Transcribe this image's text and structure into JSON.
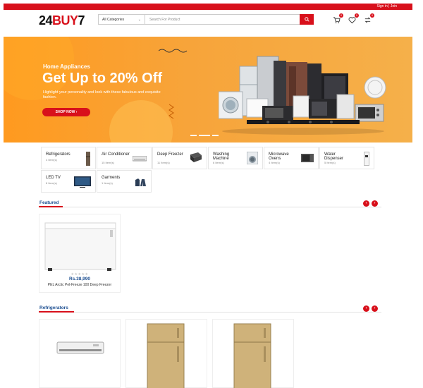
{
  "topbar": {
    "auth": "Sign in | Join"
  },
  "header": {
    "logo_main": "24",
    "logo_red": "BUY",
    "logo_end": "7",
    "category_select": "All Categories",
    "search_placeholder": "Search For Product",
    "cart_count": "0",
    "wishlist_count": "0",
    "compare_count": "0"
  },
  "hero": {
    "kicker": "Home Appliances",
    "headline": "Get Up to 20% Off",
    "subtext": "Highlight your personality and look with these fabulous and exquisite fashion.",
    "cta": "SHOP NOW",
    "slides": 3,
    "active_slide": 2
  },
  "categories": [
    {
      "name": "Refrigerators",
      "count": "4 Item(s)"
    },
    {
      "name": "Air Conditioner",
      "count": "15 Item(s)"
    },
    {
      "name": "Deep Freezer",
      "count": "11 Item(s)"
    },
    {
      "name": "Washing Machine",
      "count": "6 Item(s)"
    },
    {
      "name": "Microwave Ovens",
      "count": "4 Item(s)"
    },
    {
      "name": "Water Dispenser",
      "count": "5 Item(s)"
    },
    {
      "name": "LED TV",
      "count": "8 Item(s)"
    },
    {
      "name": "Garments",
      "count": "1 Item(s)"
    }
  ],
  "featured": {
    "title": "Featured",
    "products": [
      {
        "rating": "★★★★★",
        "price": "Rs.38,990",
        "name": "PEL Arctic Pel-Freeze 100 Deep Freezer"
      }
    ]
  },
  "refrigerators": {
    "title": "Refrigerators"
  },
  "colors": {
    "brand_red": "#d8101b",
    "brand_blue": "#1d4f91",
    "hero_orange": "#ff9a1f"
  }
}
